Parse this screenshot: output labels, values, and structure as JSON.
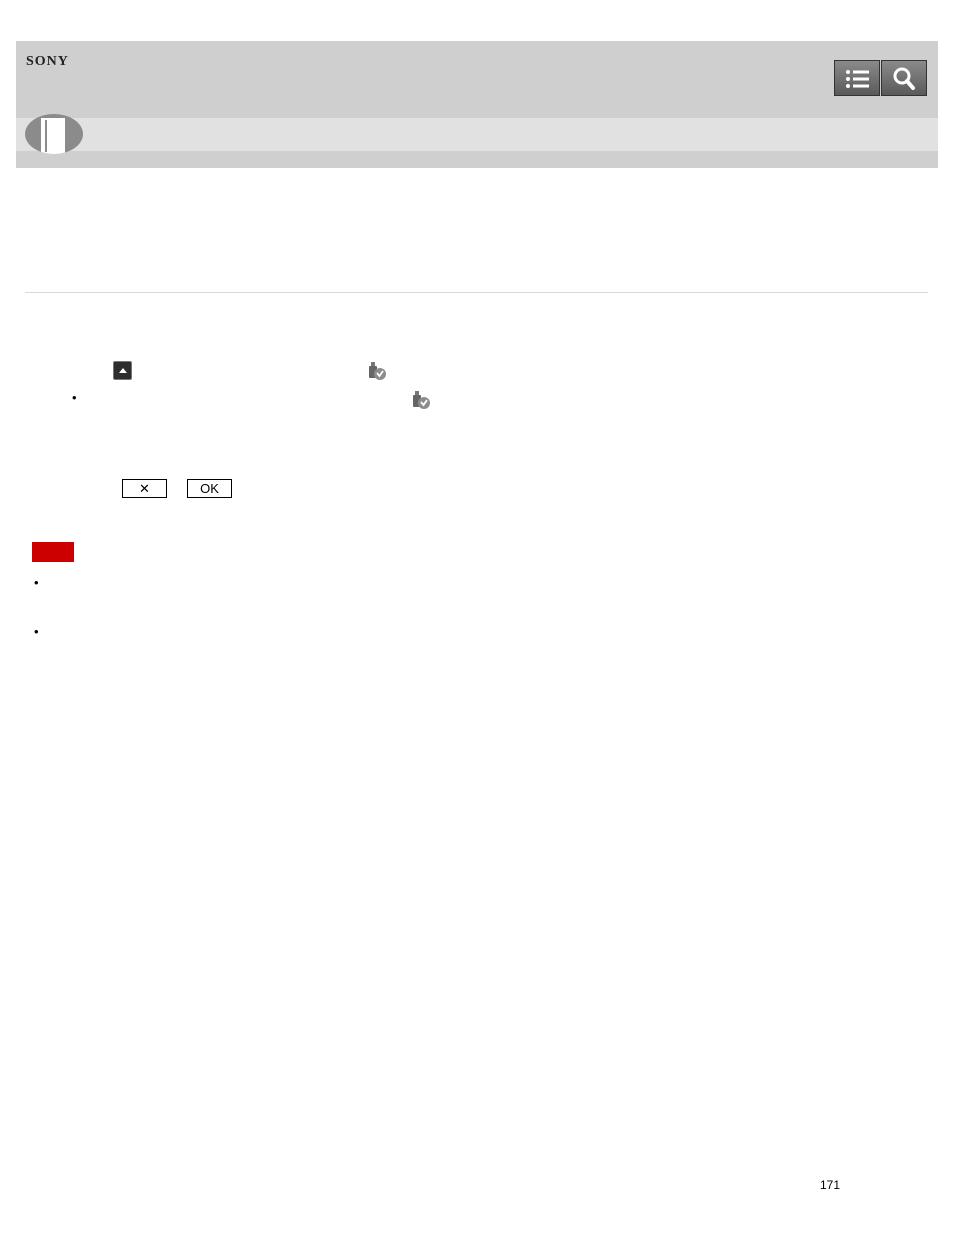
{
  "header": {
    "brand": "SONY",
    "toc_button_icon": "list-icon",
    "search_button_icon": "search-icon",
    "book_icon": "book-icon"
  },
  "icons": {
    "up_arrow": "up-arrow-icon",
    "usb_protect": "usb-protect-icon"
  },
  "controls": {
    "cancel_label": "✕",
    "ok_label": "OK"
  },
  "note": {
    "color": "#cc0000"
  },
  "bullets": [
    "•",
    "•",
    "•"
  ],
  "footer": {
    "page_number": "171"
  }
}
